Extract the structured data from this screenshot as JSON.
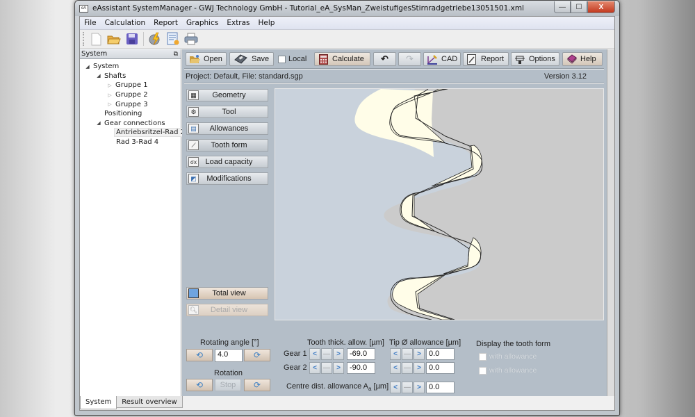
{
  "window": {
    "title": "eAssistant SystemManager - GWJ Technology GmbH - Tutorial_eA_SysMan_ZweistufigesStirnradgetriebe13051501.xml",
    "app_icon_text": "eA",
    "controls": {
      "minimize": "—",
      "maximize": "☐",
      "close": "X"
    }
  },
  "menubar": [
    "File",
    "Calculation",
    "Report",
    "Graphics",
    "Extras",
    "Help"
  ],
  "toolbar_icons": [
    "new-document-icon",
    "open-folder-icon",
    "save-disk-icon",
    "calculate-lightning-icon",
    "report-icon",
    "print-icon"
  ],
  "system_panel": {
    "header": "System",
    "tree": [
      {
        "label": "System",
        "level": 0,
        "toggle": "expanded"
      },
      {
        "label": "Shafts",
        "level": 1,
        "toggle": "expanded"
      },
      {
        "label": "Gruppe 1",
        "level": 2,
        "toggle": "collapsed"
      },
      {
        "label": "Gruppe 2",
        "level": 2,
        "toggle": "collapsed"
      },
      {
        "label": "Gruppe 3",
        "level": 2,
        "toggle": "collapsed"
      },
      {
        "label": "Positioning",
        "level": 1,
        "toggle": "none"
      },
      {
        "label": "Gear connections",
        "level": 1,
        "toggle": "expanded"
      },
      {
        "label": "Antriebsritzel-Rad 2",
        "level": 2,
        "toggle": "none",
        "selected": true
      },
      {
        "label": "Rad 3-Rad 4",
        "level": 2,
        "toggle": "none"
      }
    ],
    "tabs": {
      "system": "System",
      "result_overview": "Result overview"
    }
  },
  "main_toolbar": {
    "open": "Open",
    "save": "Save",
    "local": "Local",
    "local_checked": false,
    "calculate": "Calculate",
    "undo": "↶",
    "redo": "↷",
    "cad": "CAD",
    "report": "Report",
    "options": "Options",
    "help": "Help"
  },
  "project_info": "Project: Default, File: standard.sgp",
  "version": "Version 3.12",
  "side_nav": {
    "geometry": "Geometry",
    "tool": "Tool",
    "allowances": "Allowances",
    "tooth_form": "Tooth form",
    "load_capacity": "Load capacity",
    "modifications": "Modifications",
    "total_view": "Total view",
    "detail_view": "Detail view"
  },
  "rotation": {
    "angle_label": "Rotating angle [°]",
    "angle_value": "4.0",
    "rotation_label": "Rotation",
    "stop": "Stop"
  },
  "allowances": {
    "tooth_thick_header": "Tooth thick. allow. [µm]",
    "tip_header": "Tip Ø allowance [µm]",
    "gear1_label": "Gear 1",
    "gear2_label": "Gear 2",
    "gear1_tooth_thick": "-69.0",
    "gear2_tooth_thick": "-90.0",
    "gear1_tip": "0.0",
    "gear2_tip": "0.0",
    "centre_dist_label": "Centre dist. allowance A",
    "centre_dist_sub": "a",
    "centre_dist_unit": " [µm]",
    "centre_dist_value": "0.0",
    "stepper": {
      "left": "<",
      "mid": "—",
      "right": ">"
    }
  },
  "display_tooth_form": {
    "header": "Display the tooth form",
    "options": [
      "with allowance",
      "with allowance"
    ]
  },
  "colors": {
    "panel_bg": "#b4bec8",
    "canvas_left": "#c9d2dc",
    "canvas_right": "#cbcbcb",
    "tooth_fill": "#fffde8",
    "outline": "#2a2a2a"
  }
}
